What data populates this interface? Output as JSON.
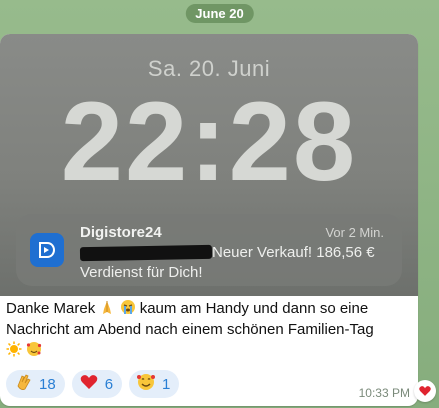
{
  "chat": {
    "date_label": "June 20"
  },
  "lockscreen": {
    "date": "Sa. 20. Juni",
    "time": "22:28"
  },
  "notification": {
    "app_name": "Digistore24",
    "age": "Vor 2 Min.",
    "line1": "Neuer Verkauf! 186,56 €",
    "line2": "Verdienst für Dich!"
  },
  "message": {
    "text_part1": "Danke Marek ",
    "text_part2": "  kaum am Handy und dann so eine Nachricht am Abend nach einem schönen Familien-Tag ",
    "time": "10:33 PM"
  },
  "reactions": [
    {
      "icon": "clapping-hands-icon",
      "count": "18"
    },
    {
      "icon": "red-heart-icon",
      "count": "6"
    },
    {
      "icon": "smiling-face-with-hearts-icon",
      "count": "1"
    }
  ],
  "colors": {
    "reaction_bg": "#e4eefa",
    "reaction_text": "#2a7fd4",
    "app_icon": "#1f6fd1"
  }
}
